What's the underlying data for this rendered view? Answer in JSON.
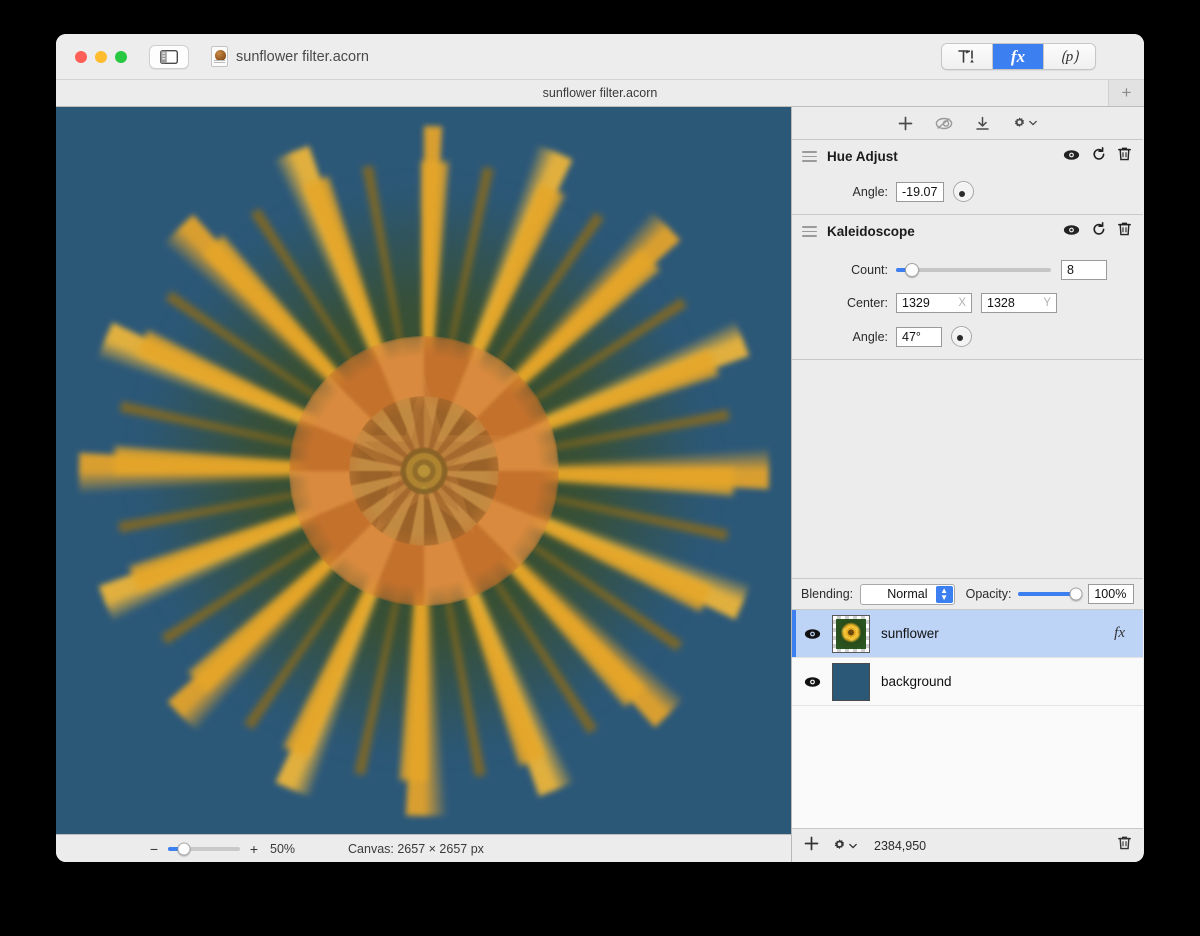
{
  "window": {
    "title": "sunflower filter.acorn",
    "document_tab_title": "sunflower filter.acorn",
    "add_tab_label": "+",
    "traffic_lights": [
      "close-button",
      "minimize-button",
      "zoom-button"
    ]
  },
  "toolbar": {
    "sidebar_toggle": "sidebar-toggle",
    "segments": [
      {
        "id": "tools",
        "label": "⚒",
        "active": false
      },
      {
        "id": "filters",
        "label": "fx",
        "active": true
      },
      {
        "id": "presets",
        "label": "(p)",
        "active": false
      }
    ]
  },
  "filter_toolbar": {
    "add_label": "+",
    "preview_label": "◎",
    "export_label": "⤓",
    "gear_label": "⚙",
    "gear_caret": "▾"
  },
  "filters": [
    {
      "name": "Hue Adjust",
      "visible_icon": "eye-icon",
      "reset_icon": "reset-icon",
      "delete_icon": "trash-icon",
      "controls": [
        {
          "type": "angle",
          "label": "Angle:",
          "value": "-19.07",
          "dial_deg": 199
        }
      ]
    },
    {
      "name": "Kaleidoscope",
      "visible_icon": "eye-icon",
      "reset_icon": "reset-icon",
      "delete_icon": "trash-icon",
      "controls": [
        {
          "type": "slider",
          "label": "Count:",
          "value": "8",
          "percent": 10
        },
        {
          "type": "point",
          "label": "Center:",
          "x": "1329",
          "y": "1328",
          "x_tag": "X",
          "y_tag": "Y"
        },
        {
          "type": "angle",
          "label": "Angle:",
          "value": "47°",
          "dial_deg": 227
        }
      ]
    }
  ],
  "blending": {
    "label": "Blending:",
    "mode": "Normal",
    "opacity_label": "Opacity:",
    "opacity_value": "100%",
    "opacity_percent": 100
  },
  "layers": [
    {
      "name": "sunflower",
      "selected": true,
      "visible": true,
      "has_fx": true,
      "fx_label": "fx",
      "thumb": "image"
    },
    {
      "name": "background",
      "selected": false,
      "visible": true,
      "has_fx": false,
      "fx_label": "",
      "thumb": "color"
    }
  ],
  "layers_bottom": {
    "add_label": "+",
    "gear_label": "⚙",
    "gear_caret": "▾",
    "coordinates": "2384,950",
    "delete_label": "trash-icon"
  },
  "canvas_status": {
    "zoom_out": "−",
    "zoom_in": "+",
    "zoom_value": "50%",
    "zoom_percent": 22,
    "canvas_info": "Canvas: 2657 × 2657 px"
  },
  "colors": {
    "accent": "#3b7ff0",
    "selection": "#bdd4f7",
    "canvas_background": "#2c5878",
    "panel": "#ececec"
  }
}
